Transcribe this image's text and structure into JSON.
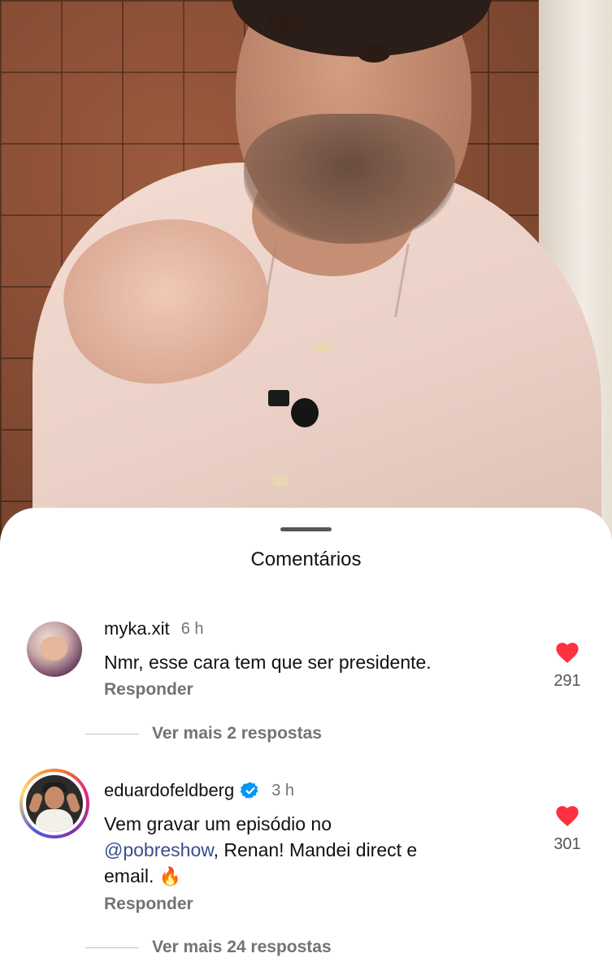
{
  "sheet": {
    "title": "Comentários"
  },
  "comments": [
    {
      "username": "myka.xit",
      "verified": false,
      "time": "6 h",
      "text": "Nmr, esse cara tem que ser presidente.",
      "reply_label": "Responder",
      "likes": "291",
      "more_replies": "Ver mais 2 respostas"
    },
    {
      "username": "eduardofeldberg",
      "verified": true,
      "time": "3 h",
      "text_line1": "Vem gravar um episódio no",
      "mention": "@pobreshow",
      "text_line2": ", Renan! Mandei direct e",
      "text_line3": "email. ",
      "emoji": "🔥",
      "reply_label": "Responder",
      "likes": "301",
      "more_replies": "Ver mais 24 respostas"
    }
  ],
  "colors": {
    "heart": "#ff3040",
    "verified": "#0095f6",
    "secondary_text": "#737373",
    "mention": "#3a4e8c"
  },
  "icons": {
    "like": "heart-icon",
    "verified": "verified-badge-icon"
  }
}
